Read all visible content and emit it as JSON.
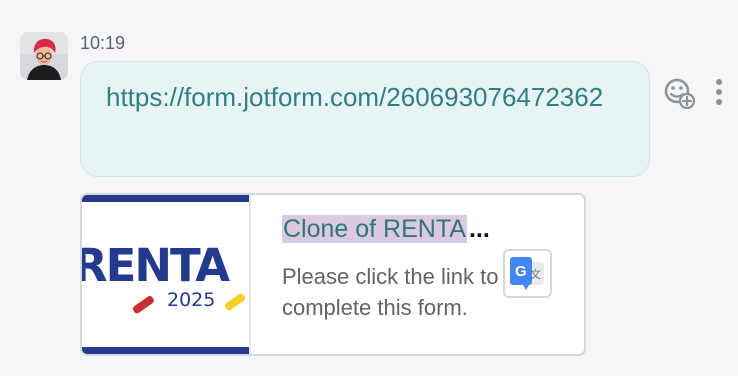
{
  "message": {
    "time": "10:19",
    "link_text": "https://form.jotform.com/260693076472362"
  },
  "preview": {
    "title": "Clone of RENTA",
    "title_ellipsis": "...",
    "description": "Please click the link to complete this form.",
    "description_line1": "Please click the link to",
    "description_line2": "complete this form.",
    "logo_text": "RENTA",
    "logo_year": "2025"
  },
  "icons": {
    "reaction": "add-reaction-icon",
    "more": "more-options-icon",
    "translate": "google-translate-icon"
  },
  "colors": {
    "bubble_background": "#e8f4f4",
    "link_text": "#2f7f84",
    "preview_title": "#307679",
    "title_highlight": "#dbc9e1",
    "logo_blue": "#243a8f",
    "logo_red": "#c92f2f",
    "logo_yellow": "#f4d02d",
    "translate_blue": "#4285f4"
  }
}
